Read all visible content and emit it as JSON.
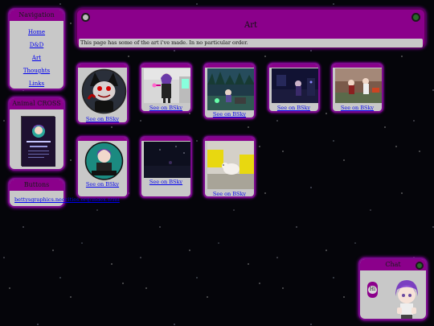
{
  "navigation": {
    "title": "Navigation",
    "links": [
      "Home",
      "D&D",
      "Art",
      "Thoughts",
      "Links"
    ]
  },
  "badge_panel": {
    "title": "Animal CROSS"
  },
  "button_panel": {
    "title": "Buttons",
    "url": "bettysgraphics.neocities.org/index.html"
  },
  "main": {
    "title": "Art",
    "description": "This page has some of the art i've made. In no particular order."
  },
  "gallery": {
    "link_label": "See on BSky",
    "items": [
      "circle-portrait-red-eyes-character",
      "girl-in-room-with-wand",
      "forest-scene-teal",
      "dark-room-character-night",
      "outdoor-scene-with-figures",
      "circle-portrait-purple-hair-character",
      "dark-sky-scene",
      "white-cat-on-yellow"
    ]
  },
  "chat_panel": {
    "title": "Chat",
    "bubble": "Hi"
  },
  "colors": {
    "accent": "#8b008b",
    "panel": "#c8c8c8",
    "link": "#0000ee"
  }
}
